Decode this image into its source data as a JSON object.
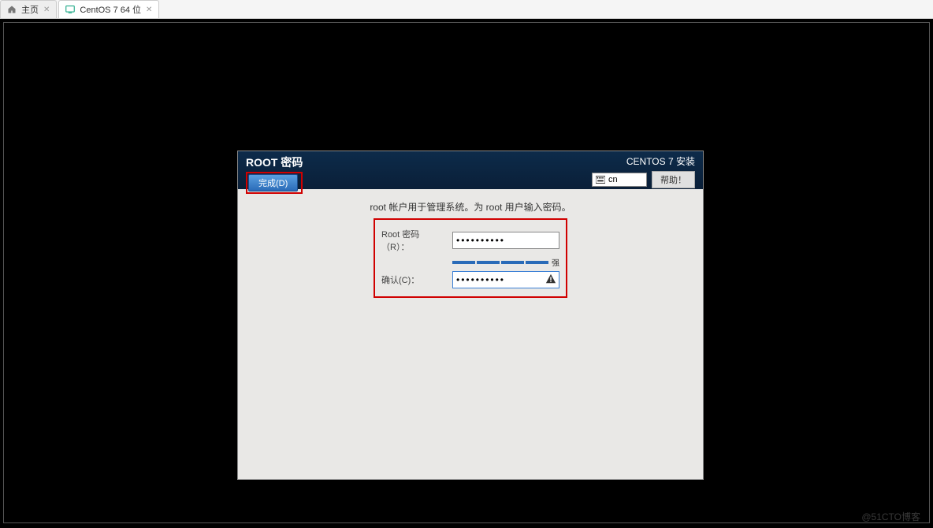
{
  "tabs": {
    "home": {
      "label": "主页"
    },
    "vm": {
      "label": "CentOS 7 64 位"
    }
  },
  "centos": {
    "title": "ROOT 密码",
    "done_label": "完成(D)",
    "install_title": "CENTOS 7 安装",
    "keyboard": "cn",
    "help_label": "帮助！",
    "instruction": "root 帐户用于管理系统。为 root 用户输入密码。",
    "password_label": "Root 密码 （R）：",
    "password_value": "••••••••••",
    "strength_label": "强",
    "confirm_label": "确认(C)：",
    "confirm_value": "••••••••••"
  },
  "watermark": "@51CTO博客"
}
